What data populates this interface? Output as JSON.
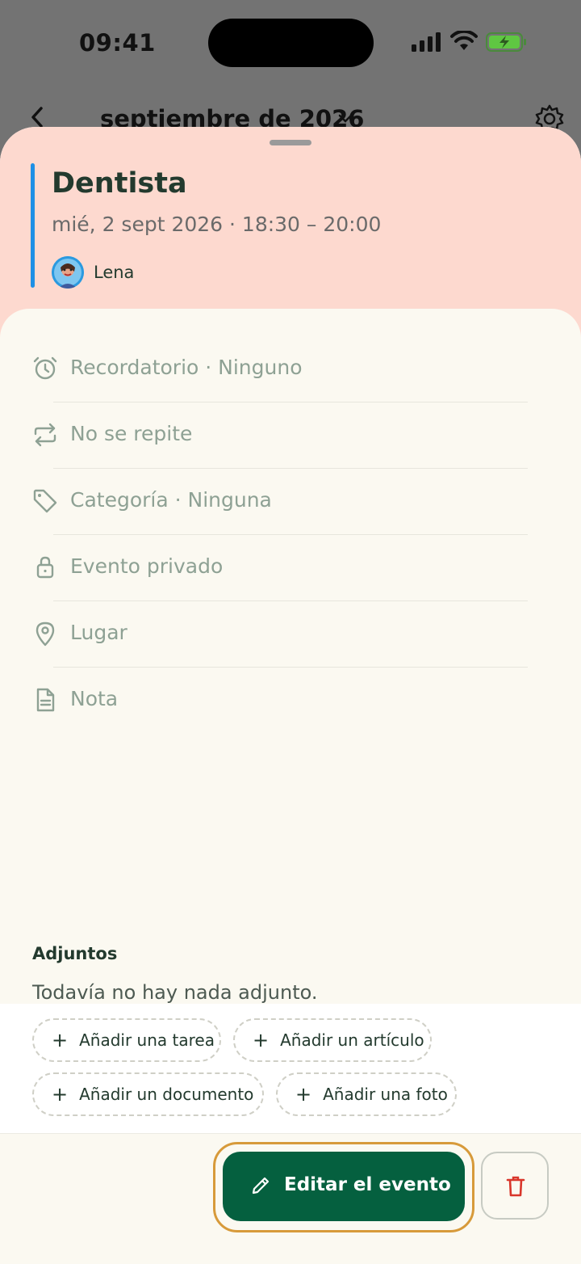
{
  "status_bar": {
    "time": "09:41"
  },
  "background": {
    "month_title": "septiembre de 2026"
  },
  "event": {
    "title": "Dentista",
    "when": "mié, 2 sept 2026 · 18:30 – 20:00",
    "person": "Lena",
    "accent_color": "#1e90e6",
    "header_color": "#fdd9cf"
  },
  "details": [
    {
      "icon": "alarm-clock-icon",
      "label": "Recordatorio · Ninguno"
    },
    {
      "icon": "repeat-icon",
      "label": "No se repite"
    },
    {
      "icon": "tag-icon",
      "label": "Categoría · Ninguna"
    },
    {
      "icon": "lock-icon",
      "label": "Evento privado"
    },
    {
      "icon": "location-pin-icon",
      "label": "Lugar"
    },
    {
      "icon": "note-document-icon",
      "label": "Nota"
    }
  ],
  "attachments": {
    "title": "Adjuntos",
    "empty_text": "Todavía no hay nada adjunto.",
    "chips": [
      "Añadir una tarea",
      "Añadir un artículo",
      "Añadir un documento",
      "Añadir una foto"
    ]
  },
  "footer": {
    "edit_label": "Editar el evento",
    "edit_color": "#05603f",
    "delete_icon": "trash-icon",
    "delete_color": "#d9362b"
  }
}
